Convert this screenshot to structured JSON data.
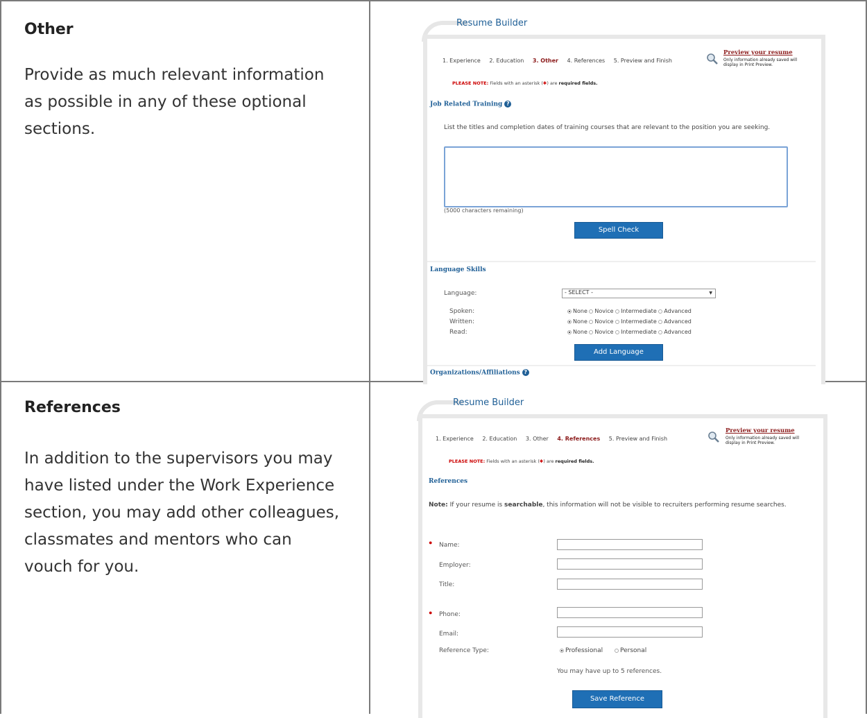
{
  "rows": [
    {
      "heading": "Other",
      "body": "Provide as much relevant information as possible in any of these optional sections."
    },
    {
      "heading": "References",
      "body": "In addition to the supervisors you may have listed under the Work Experience section, you may add other colleagues, classmates and mentors who can vouch for you."
    }
  ],
  "other_screen": {
    "title": "Resume Builder",
    "steps": [
      "1. Experience",
      "2. Education",
      "3. Other",
      "4. References",
      "5. Preview and Finish"
    ],
    "active_step": "3. Other",
    "preview_link": "Preview your resume",
    "preview_note": "Only information already saved will display in Print Preview.",
    "note_prefix": "PLEASE NOTE:",
    "note_mid": " Fields with an asterisk (",
    "note_star": "✱",
    "note_end_pre": ") are ",
    "note_end_bold": "required fields.",
    "training_title": "Job Related Training",
    "training_desc": "List the titles and completion dates of training courses that are relevant to the position you are seeking.",
    "chars_remaining": "(5000 characters remaining)",
    "spell_check": "Spell Check",
    "language_title": "Language Skills",
    "language_label": "Language:",
    "language_select": "- SELECT -",
    "spoken_label": "Spoken:",
    "written_label": "Written:",
    "read_label": "Read:",
    "levels": [
      "None",
      "Novice",
      "Intermediate",
      "Advanced"
    ],
    "add_language": "Add Language",
    "org_title": "Organizations/Affiliations"
  },
  "ref_screen": {
    "title": "Resume Builder",
    "steps": [
      "1. Experience",
      "2. Education",
      "3. Other",
      "4. References",
      "5. Preview and Finish"
    ],
    "active_step": "4. References",
    "preview_link": "Preview your resume",
    "preview_note": "Only information already saved will display in Print Preview.",
    "note_prefix": "PLEASE NOTE:",
    "note_mid": " Fields with an asterisk (",
    "note_star": "✱",
    "note_end_pre": ") are ",
    "note_end_bold": "required fields.",
    "section_title": "References",
    "note_label": "Note:",
    "note_text_1": " If your resume is ",
    "note_bold": "searchable",
    "note_text_2": ", this information will not be visible to recruiters performing resume searches.",
    "name_label": "Name:",
    "employer_label": "Employer:",
    "title_label": "Title:",
    "phone_label": "Phone:",
    "email_label": "Email:",
    "ref_type_label": "Reference Type:",
    "ref_professional": "Professional",
    "ref_personal": "Personal",
    "limit_text": "You may have up to 5 references.",
    "save_button": "Save Reference"
  },
  "colors": {
    "accent": "#1f6fb5",
    "title_blue": "#1f5f96",
    "active_step": "#8b1a1a",
    "required": "#cc0000"
  }
}
